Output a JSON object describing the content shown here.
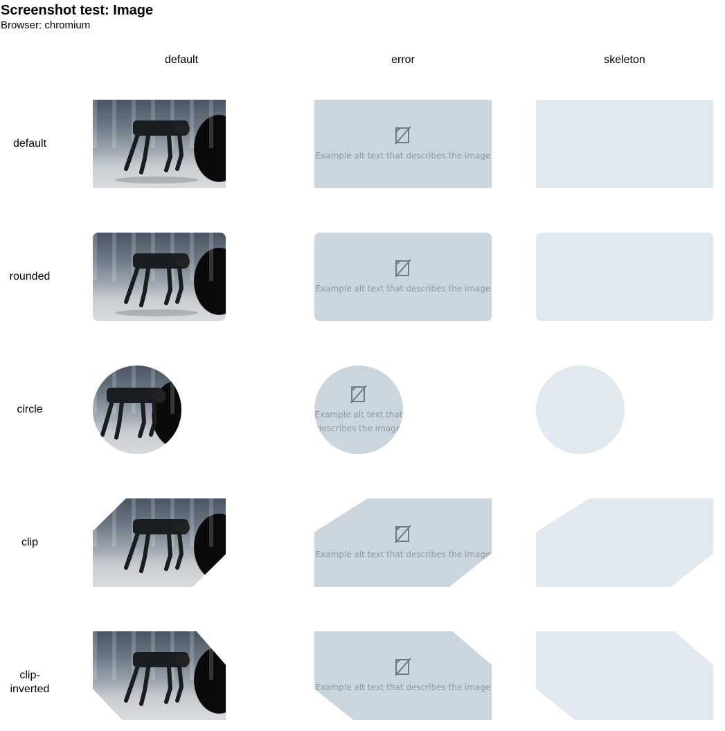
{
  "header": {
    "title": "Screenshot test: Image",
    "subtitle": "Browser: chromium"
  },
  "columns": [
    "default",
    "error",
    "skeleton"
  ],
  "rows": [
    "default",
    "rounded",
    "circle",
    "clip",
    "clip-inverted"
  ],
  "image": {
    "alt": "Example alt text that describes the image",
    "circle_alt_line1": "Example alt text that",
    "circle_alt_line2": "describes the image"
  },
  "colors": {
    "error_bg": "#cad5de",
    "skeleton_bg": "#e2e8ef",
    "error_text": "#8a99a8",
    "error_icon": "#6b7a89"
  },
  "icons": [
    "broken-image-icon"
  ]
}
